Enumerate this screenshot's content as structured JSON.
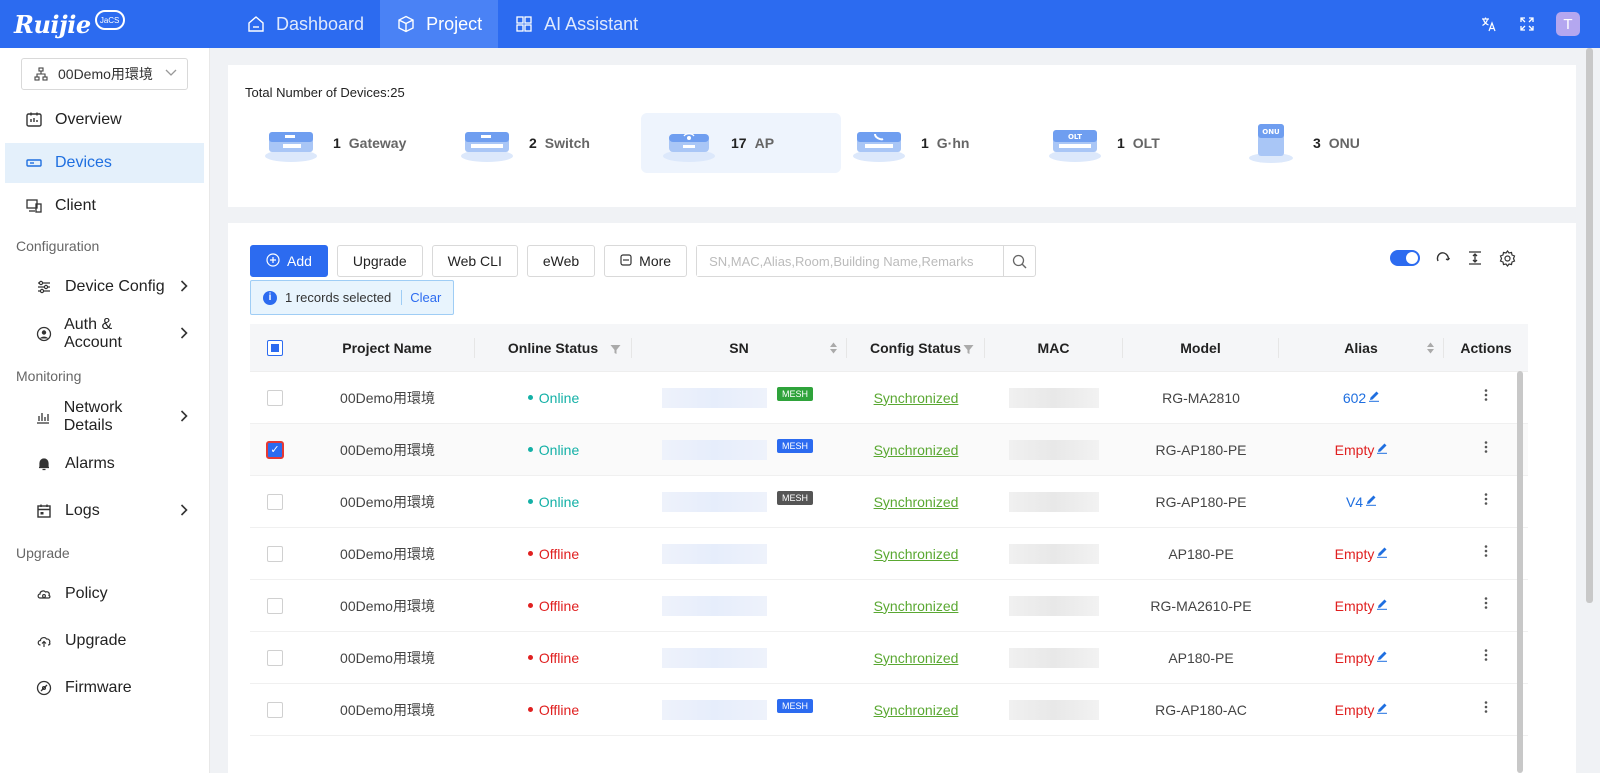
{
  "brand": {
    "name": "Ruijie",
    "sub": "JaCS"
  },
  "nav": [
    {
      "label": "Dashboard",
      "icon": "home-icon",
      "active": false
    },
    {
      "label": "Project",
      "icon": "cube-icon",
      "active": true
    },
    {
      "label": "AI Assistant",
      "icon": "grid-icon",
      "active": false
    }
  ],
  "user": {
    "avatar": "T"
  },
  "sidebar": {
    "project": "00Demo用環境",
    "items": [
      {
        "label": "Overview"
      },
      {
        "label": "Devices"
      },
      {
        "label": "Client"
      }
    ],
    "groups": {
      "configuration": "Configuration",
      "monitoring": "Monitoring",
      "upgrade": "Upgrade"
    },
    "config_items": [
      {
        "label": "Device Config"
      },
      {
        "label": "Auth & Account"
      }
    ],
    "monitor_items": [
      {
        "label": "Network Details"
      },
      {
        "label": "Alarms"
      },
      {
        "label": "Logs"
      }
    ],
    "upgrade_items": [
      {
        "label": "Policy"
      },
      {
        "label": "Upgrade"
      },
      {
        "label": "Firmware"
      }
    ]
  },
  "summary": {
    "title": "Total Number of Devices:25",
    "types": [
      {
        "count": "1",
        "label": "Gateway"
      },
      {
        "count": "2",
        "label": "Switch"
      },
      {
        "count": "17",
        "label": "AP"
      },
      {
        "count": "1",
        "label": "G·hn"
      },
      {
        "count": "1",
        "label": "OLT"
      },
      {
        "count": "3",
        "label": "ONU"
      }
    ]
  },
  "toolbar": {
    "add": "Add",
    "upgrade": "Upgrade",
    "webcli": "Web CLI",
    "eweb": "eWeb",
    "more": "More",
    "search_placeholder": "SN,MAC,Alias,Room,Building Name,Remarks"
  },
  "selection": {
    "text": "1 records selected",
    "clear": "Clear"
  },
  "table": {
    "headers": {
      "project": "Project Name",
      "online": "Online Status",
      "sn": "SN",
      "config": "Config Status",
      "mac": "MAC",
      "model": "Model",
      "alias": "Alias",
      "actions": "Actions"
    },
    "rows": [
      {
        "project": "00Demo用環境",
        "status": "Online",
        "config": "Synchronized",
        "model": "RG-MA2810",
        "alias": "602",
        "mesh": "MESH"
      },
      {
        "project": "00Demo用環境",
        "status": "Online",
        "config": "Synchronized",
        "model": "RG-AP180-PE",
        "alias": "Empty",
        "mesh": "MESH"
      },
      {
        "project": "00Demo用環境",
        "status": "Online",
        "config": "Synchronized",
        "model": "RG-AP180-PE",
        "alias": "V4",
        "mesh": "MESH"
      },
      {
        "project": "00Demo用環境",
        "status": "Offline",
        "config": "Synchronized",
        "model": "AP180-PE",
        "alias": "Empty",
        "mesh": ""
      },
      {
        "project": "00Demo用環境",
        "status": "Offline",
        "config": "Synchronized",
        "model": "RG-MA2610-PE",
        "alias": "Empty",
        "mesh": ""
      },
      {
        "project": "00Demo用環境",
        "status": "Offline",
        "config": "Synchronized",
        "model": "AP180-PE",
        "alias": "Empty",
        "mesh": ""
      },
      {
        "project": "00Demo用環境",
        "status": "Offline",
        "config": "Synchronized",
        "model": "RG-AP180-AC",
        "alias": "Empty",
        "mesh": "MESH"
      }
    ]
  },
  "colors": {
    "primary": "#2c6bf0",
    "online": "#13b0a6",
    "offline": "#e02020",
    "synced": "#5aa832"
  }
}
